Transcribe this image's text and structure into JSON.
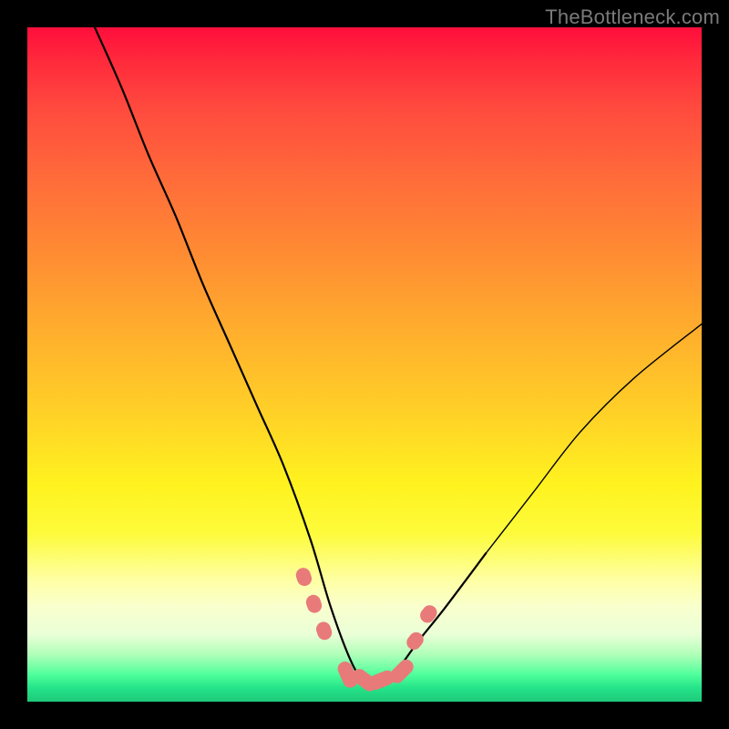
{
  "watermark": "TheBottleneck.com",
  "colors": {
    "marker": "#e87a7a",
    "curve": "#000000"
  },
  "chart_data": {
    "type": "line",
    "title": "",
    "xlabel": "",
    "ylabel": "",
    "xlim": [
      0,
      100
    ],
    "ylim": [
      0,
      100
    ],
    "grid": false,
    "curve": {
      "description": "V-shaped bottleneck curve; minimum (best match) sits around x≈50 near y≈3; left branch starts near top at x≈10, right branch rises toward x≈100 around y≈55.",
      "x": [
        10,
        14,
        18,
        22,
        26,
        30,
        34,
        38,
        42,
        45,
        48,
        50,
        52,
        55,
        58,
        62,
        68,
        75,
        82,
        90,
        100
      ],
      "y": [
        100,
        91,
        81,
        72,
        62,
        53,
        44,
        35,
        24,
        14,
        6,
        3,
        3,
        5,
        9,
        14,
        22,
        31,
        40,
        48,
        56
      ]
    },
    "markers": {
      "description": "Highlighted points (pink capsules) clustered near the valley.",
      "points": [
        {
          "x": 41.0,
          "y": 18.5
        },
        {
          "x": 42.5,
          "y": 14.5
        },
        {
          "x": 44.0,
          "y": 10.5
        },
        {
          "x": 47.5,
          "y": 4.0
        },
        {
          "x": 50.0,
          "y": 3.2
        },
        {
          "x": 52.5,
          "y": 3.2
        },
        {
          "x": 55.5,
          "y": 4.5
        },
        {
          "x": 57.5,
          "y": 9.0
        },
        {
          "x": 59.5,
          "y": 13.0
        }
      ]
    }
  }
}
